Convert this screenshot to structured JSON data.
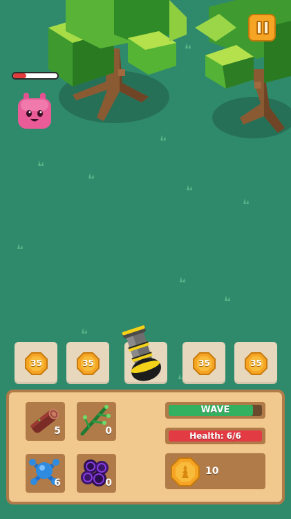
{
  "colors": {
    "ground": "#2f8a6c",
    "panel": "#f1c98f",
    "panel_border": "#b07b48",
    "wave_fill": "#33b060",
    "health_fill": "#e33b44",
    "coin": "#f5a523"
  },
  "enemy": {
    "health_fraction": 0.3
  },
  "tower_slots": [
    {
      "cost": "35",
      "icon": "coin-icon"
    },
    {
      "cost": "35",
      "icon": "coin-icon"
    },
    {
      "icon": "cannon-icon"
    },
    {
      "cost": "35",
      "icon": "coin-icon"
    },
    {
      "cost": "35",
      "icon": "coin-icon"
    }
  ],
  "resources": {
    "wood": {
      "count": "5",
      "icon": "log-icon"
    },
    "vine": {
      "count": "0",
      "icon": "branch-icon"
    },
    "blue_orb": {
      "count": "6",
      "icon": "blue-molecule-icon"
    },
    "purple_orb": {
      "count": "0",
      "icon": "purple-cluster-icon"
    }
  },
  "status": {
    "wave_label": "WAVE",
    "wave_progress": 0.9,
    "health_label": "Health: 6/6",
    "health_fraction": 1.0,
    "coins": "10"
  }
}
